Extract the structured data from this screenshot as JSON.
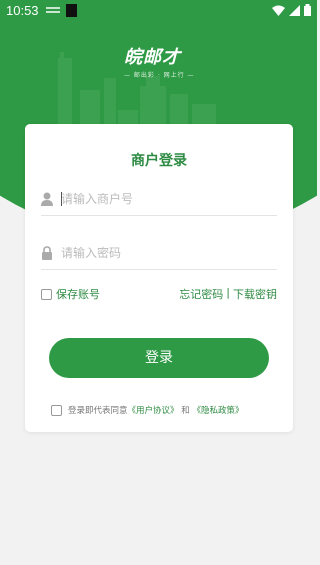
{
  "status_bar": {
    "time": "10:53"
  },
  "logo": {
    "mark": "皖邮才",
    "tagline": "— 邮出彩 · 网上行 —"
  },
  "card": {
    "title": "商户登录",
    "account_placeholder": "请输入商户号",
    "password_placeholder": "请输入密码",
    "remember_label": "保存账号",
    "forgot_label": "忘记密码",
    "separator": "|",
    "download_key_label": "下载密钥",
    "login_button": "登录",
    "agree_prefix": "登录即代表同意",
    "user_agreement": "《用户协议》",
    "agree_and": "和",
    "privacy_policy": "《隐私政策》"
  },
  "colors": {
    "brand_green": "#2e9a45",
    "link_green": "#2e8b43"
  }
}
